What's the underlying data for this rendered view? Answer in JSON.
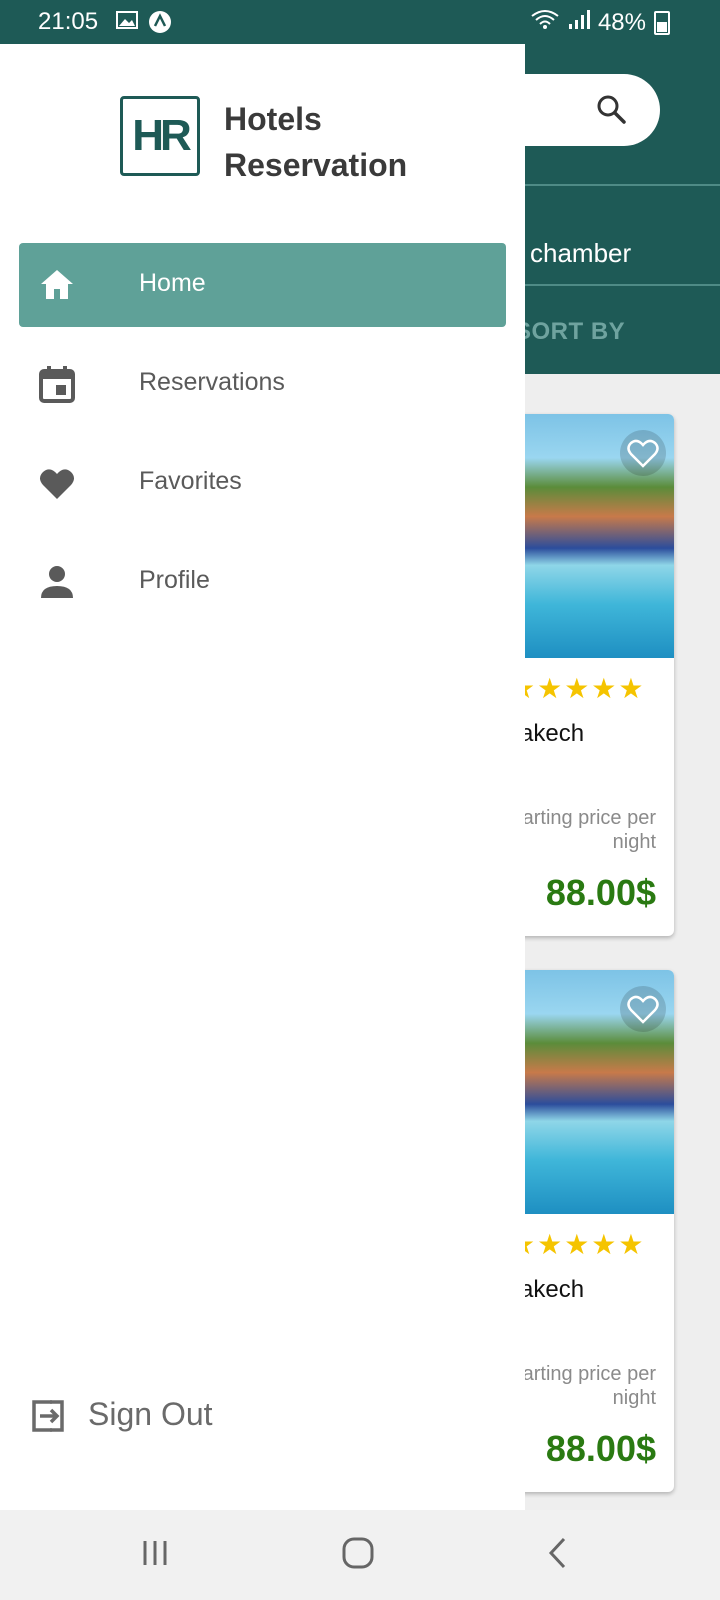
{
  "status_bar": {
    "time": "21:05",
    "battery": "48%",
    "icons": [
      "image-icon",
      "app-notification-icon",
      "wifi-icon",
      "signal-icon",
      "battery-icon"
    ]
  },
  "background": {
    "category_text": "chamber",
    "sort_label": "SORT BY",
    "cards": [
      {
        "city": "akech",
        "rating_stars": "★★★★★",
        "price_label": "Starting price per night",
        "price": "88.00$"
      },
      {
        "city": "akech",
        "rating_stars": "★★★★★",
        "price_label": "Starting price per night",
        "price": "88.00$"
      }
    ]
  },
  "drawer": {
    "logo_initials": "HR",
    "brand_line1": "Hotels",
    "brand_line2": "Reservation",
    "menu": [
      {
        "label": "Home",
        "icon": "home-icon",
        "active": true
      },
      {
        "label": "Reservations",
        "icon": "calendar-icon",
        "active": false
      },
      {
        "label": "Favorites",
        "icon": "heart-icon",
        "active": false
      },
      {
        "label": "Profile",
        "icon": "person-icon",
        "active": false
      }
    ],
    "sign_out_label": "Sign Out"
  },
  "colors": {
    "primary": "#1e5a56",
    "active_item": "#5fa198",
    "price": "#2a7a12",
    "star": "#f5c400"
  }
}
